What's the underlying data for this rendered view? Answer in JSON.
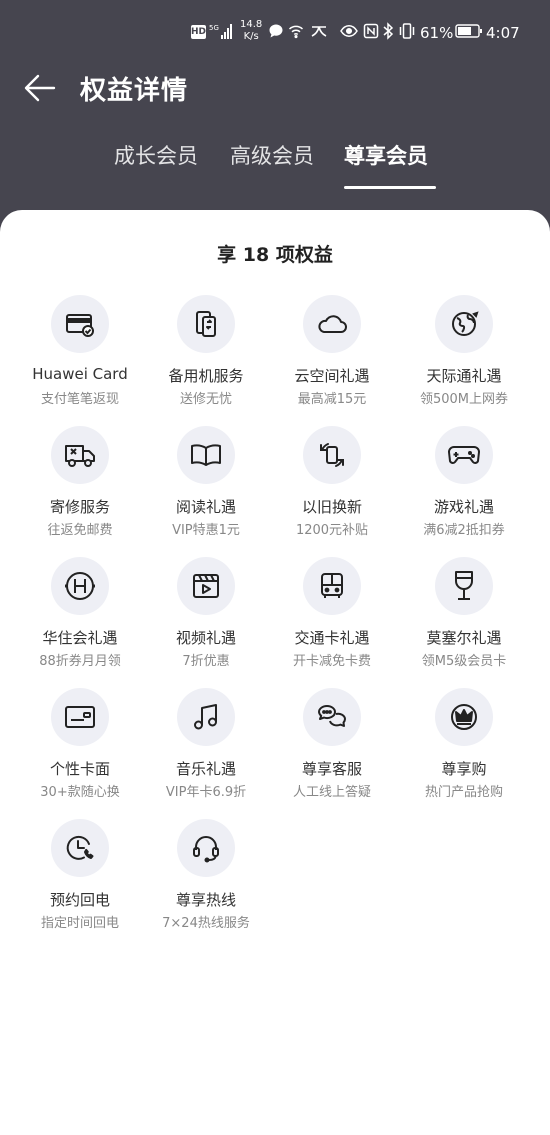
{
  "status_bar": {
    "hd": "HD",
    "network": "5G",
    "speed_value": "14.8",
    "speed_unit": "K/s",
    "battery": "61%",
    "time": "4:07"
  },
  "header": {
    "title": "权益详情",
    "tabs": [
      {
        "label": "成长会员",
        "active": false
      },
      {
        "label": "高级会员",
        "active": false
      },
      {
        "label": "尊享会员",
        "active": true
      }
    ]
  },
  "benefits_title": "享 18 项权益",
  "benefits": [
    {
      "name": "Huawei Card",
      "desc": "支付笔笔返现",
      "icon": "card-icon"
    },
    {
      "name": "备用机服务",
      "desc": "送修无忧",
      "icon": "phone-swap-icon"
    },
    {
      "name": "云空间礼遇",
      "desc": "最高减15元",
      "icon": "cloud-icon"
    },
    {
      "name": "天际通礼遇",
      "desc": "领500M上网券",
      "icon": "globe-icon"
    },
    {
      "name": "寄修服务",
      "desc": "往返免邮费",
      "icon": "truck-icon"
    },
    {
      "name": "阅读礼遇",
      "desc": "VIP特惠1元",
      "icon": "book-icon"
    },
    {
      "name": "以旧换新",
      "desc": "1200元补贴",
      "icon": "trade-in-icon"
    },
    {
      "name": "游戏礼遇",
      "desc": "满6减2抵扣券",
      "icon": "gamepad-icon"
    },
    {
      "name": "华住会礼遇",
      "desc": "88折券月月领",
      "icon": "hotel-icon"
    },
    {
      "name": "视频礼遇",
      "desc": "7折优惠",
      "icon": "video-icon"
    },
    {
      "name": "交通卡礼遇",
      "desc": "开卡减免卡费",
      "icon": "bus-icon"
    },
    {
      "name": "莫塞尔礼遇",
      "desc": "领M5级会员卡",
      "icon": "wine-icon"
    },
    {
      "name": "个性卡面",
      "desc": "30+款随心换",
      "icon": "card-face-icon"
    },
    {
      "name": "音乐礼遇",
      "desc": "VIP年卡6.9折",
      "icon": "music-icon"
    },
    {
      "name": "尊享客服",
      "desc": "人工线上答疑",
      "icon": "chat-icon"
    },
    {
      "name": "尊享购",
      "desc": "热门产品抢购",
      "icon": "crown-icon"
    },
    {
      "name": "预约回电",
      "desc": "指定时间回电",
      "icon": "clock-phone-icon"
    },
    {
      "name": "尊享热线",
      "desc": "7×24热线服务",
      "icon": "headset-icon"
    }
  ]
}
